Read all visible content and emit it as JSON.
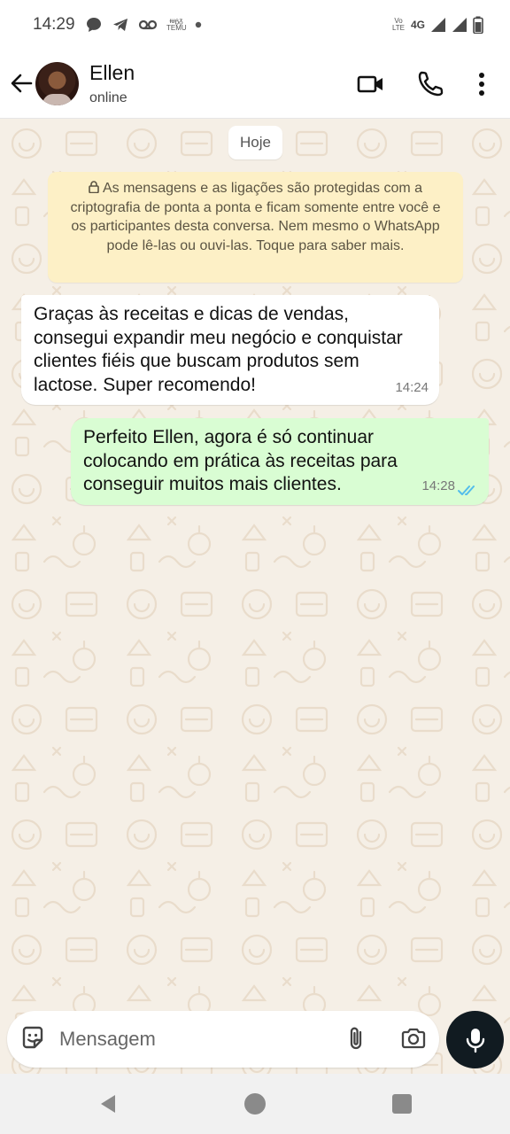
{
  "status_bar": {
    "time": "14:29",
    "left_icons": [
      "chat-bubble-icon",
      "telegram-icon",
      "voicemail-icon",
      "temu-icon",
      "dot-icon"
    ],
    "temu_label_top": "ᵻᵾᵷᵹ",
    "temu_label": "TEMU",
    "volte_top": "Vo",
    "volte_bottom": "LTE",
    "network": "4G",
    "right_icons": [
      "signal-icon",
      "signal-icon",
      "battery-icon"
    ]
  },
  "header": {
    "contact_name": "Ellen",
    "contact_status": "online",
    "icons": [
      "back-arrow-icon",
      "video-call-icon",
      "phone-icon",
      "more-vert-icon"
    ]
  },
  "chat": {
    "date_chip": "Hoje",
    "encryption_notice": "As mensagens e as ligações são protegidas com a criptografia de ponta a ponta e ficam somente entre você e os participantes desta conversa. Nem mesmo o WhatsApp pode lê-las ou ouvi-las. Toque para saber mais.",
    "messages": [
      {
        "direction": "incoming",
        "text": "Graças às receitas e dicas de vendas, consegui expandir meu negócio e conquistar clientes fiéis que buscam produtos sem lactose. Super recomendo!",
        "time": "14:24"
      },
      {
        "direction": "outgoing",
        "text": "Perfeito Ellen, agora é só continuar colocando em prática às receitas para conseguir muitos mais clientes.",
        "time": "14:28",
        "status": "read"
      }
    ]
  },
  "composer": {
    "placeholder": "Mensagem",
    "icons": [
      "sticker-icon",
      "attach-icon",
      "camera-icon",
      "mic-icon"
    ]
  },
  "colors": {
    "outgoing_bubble": "#d9fdd3",
    "incoming_bubble": "#ffffff",
    "encryption_bg": "#fdf0c6",
    "chat_bg": "#f5efe6",
    "read_ticks": "#53bdeb",
    "mic_button": "#111b21"
  }
}
